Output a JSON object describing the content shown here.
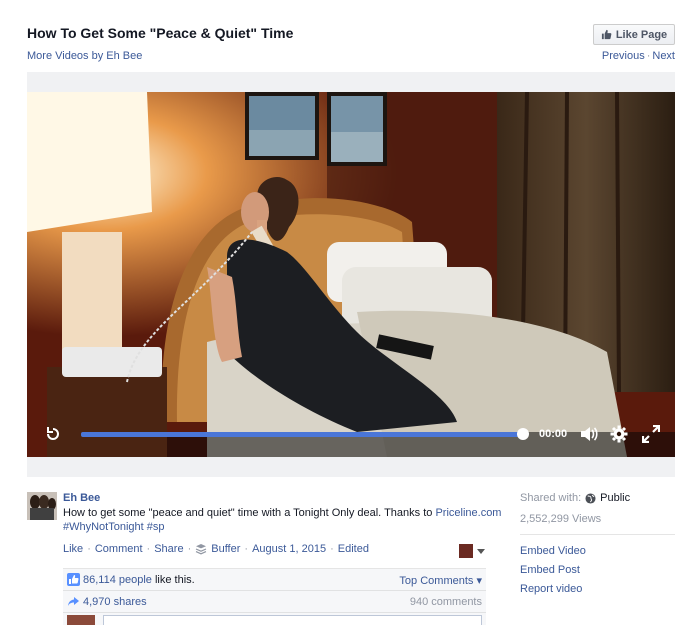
{
  "header": {
    "title": "How To Get Some \"Peace & Quiet\" Time",
    "more_videos": "More Videos by Eh Bee",
    "like_page": "Like Page",
    "previous": "Previous",
    "next": "Next",
    "separator": "·"
  },
  "player": {
    "time": "00:00",
    "progress": 1.0
  },
  "post": {
    "page_name": "Eh Bee",
    "description_text": "How to get some \"peace and quiet\" time with a Tonight Only deal. Thanks to ",
    "description_link": "Priceline.com",
    "hashtags": "#WhyNotTonight #sp",
    "actions": {
      "like": "Like",
      "comment": "Comment",
      "share": "Share",
      "buffer": "Buffer",
      "date": "August 1, 2015",
      "edited": "Edited"
    }
  },
  "ufi": {
    "likes_count": "86,114 people",
    "likes_suffix": " like this.",
    "top_comments": "Top Comments",
    "shares": "4,970 shares",
    "comments": "940 comments"
  },
  "sidebar": {
    "shared_with": "Shared with:",
    "audience": "Public",
    "views": "2,552,299 Views",
    "embed_video": "Embed Video",
    "embed_post": "Embed Post",
    "report_video": "Report video"
  },
  "colors": {
    "link": "#3b5998",
    "progress": "#4a76d8"
  },
  "icons": [
    "thumbs-up-icon",
    "replay-icon",
    "volume-icon",
    "gear-icon",
    "fullscreen-icon",
    "buffer-icon",
    "share-arrow-icon",
    "globe-icon"
  ]
}
